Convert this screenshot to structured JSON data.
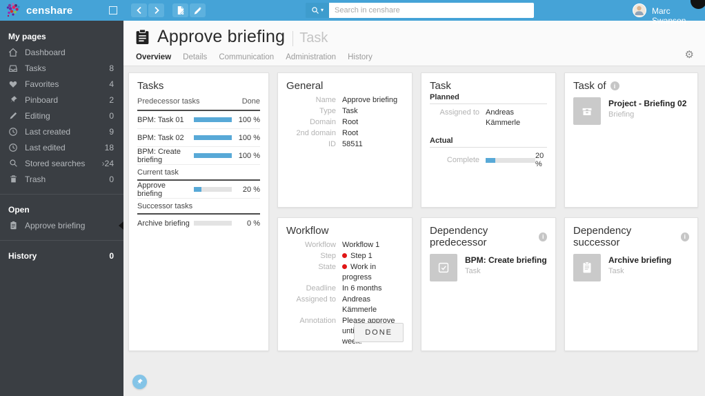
{
  "icons": {
    "gear": "⚙",
    "chevron_right": "›",
    "caret_down": "▾",
    "info": "i"
  },
  "colors": {
    "topbar_blue": "#45a3d7",
    "progress_blue": "#58a9d7",
    "status_red": "#e01616",
    "sidebar_bg": "#3a3e43"
  },
  "topbar": {
    "brand": "censhare",
    "search_placeholder": "Search in censhare",
    "user_name": "Marc Swanson"
  },
  "sidebar": {
    "my_pages_title": "My pages",
    "items": [
      {
        "label": "Dashboard",
        "count": ""
      },
      {
        "label": "Tasks",
        "count": "8"
      },
      {
        "label": "Favorites",
        "count": "4"
      },
      {
        "label": "Pinboard",
        "count": "2"
      },
      {
        "label": "Editing",
        "count": "0"
      },
      {
        "label": "Last created",
        "count": "9"
      },
      {
        "label": "Last edited",
        "count": "18"
      },
      {
        "label": "Stored searches",
        "count": "24"
      },
      {
        "label": "Trash",
        "count": "0"
      }
    ],
    "open_title": "Open",
    "open_item": "Approve briefing",
    "history_title": "History",
    "history_count": "0"
  },
  "header": {
    "title": "Approve briefing",
    "subtitle": "Task",
    "tabs": [
      "Overview",
      "Details",
      "Communication",
      "Administration",
      "History"
    ]
  },
  "tasks_card": {
    "title": "Tasks",
    "header_left": "Predecessor tasks",
    "header_right": "Done",
    "predecessors": [
      {
        "label": "BPM: Task 01",
        "percent": 100,
        "done": "100 %"
      },
      {
        "label": "BPM: Task 02",
        "percent": 100,
        "done": "100 %"
      },
      {
        "label": "BPM: Create briefing",
        "percent": 100,
        "done": "100 %"
      }
    ],
    "current_label": "Current task",
    "current": {
      "label": "Approve briefing",
      "percent": 20,
      "done": "20 %"
    },
    "successor_label": "Successor tasks",
    "successor": {
      "label": "Archive briefing",
      "percent": 0,
      "done": "0 %"
    }
  },
  "general_card": {
    "title": "General",
    "fields": [
      {
        "label": "Name",
        "value": "Approve briefing"
      },
      {
        "label": "Type",
        "value": "Task"
      },
      {
        "label": "Domain",
        "value": "Root"
      },
      {
        "label": "2nd domain",
        "value": "Root"
      },
      {
        "label": "ID",
        "value": "58511"
      }
    ]
  },
  "task_card": {
    "title": "Task",
    "planned_label": "Planned",
    "assigned_label": "Assigned to",
    "assigned_value": "Andreas Kämmerle",
    "actual_label": "Actual",
    "complete_label": "Complete",
    "complete_percent": 20,
    "complete_text": "20 %"
  },
  "task_of_card": {
    "title": "Task of",
    "item_title": "Project - Briefing 02",
    "item_subtitle": "Briefing"
  },
  "workflow_card": {
    "title": "Workflow",
    "fields": [
      {
        "label": "Workflow",
        "value": "Workflow 1"
      },
      {
        "label": "Step",
        "value": "Step 1"
      },
      {
        "label": "State",
        "value": "Work in progress"
      },
      {
        "label": "Deadline",
        "value": "In 6 months"
      },
      {
        "label": "Assigned to",
        "value": "Andreas Kämmerle"
      },
      {
        "label": "Annotation",
        "value": "Please approve until end of this week."
      }
    ],
    "done_button": "DONE"
  },
  "dep_pred_card": {
    "title": "Dependency predecessor",
    "item_title": "BPM: Create briefing",
    "item_subtitle": "Task"
  },
  "dep_succ_card": {
    "title": "Dependency successor",
    "item_title": "Archive briefing",
    "item_subtitle": "Task"
  }
}
